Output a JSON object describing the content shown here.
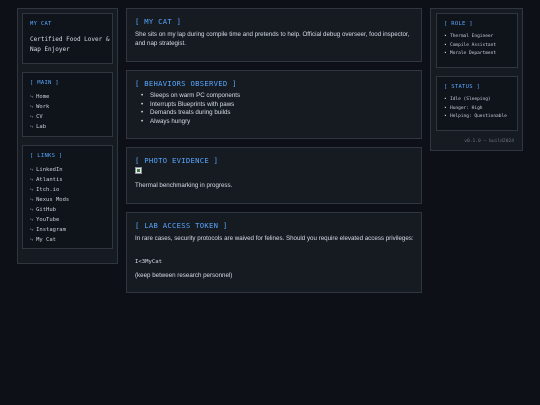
{
  "left": {
    "mycat": {
      "header": "MY CAT",
      "text": "Certified Food Lover & Nap Enjoyer"
    },
    "main": {
      "header": "[ MAIN ]",
      "items": [
        "Home",
        "Work",
        "CV",
        "Lab"
      ]
    },
    "links": {
      "header": "[ LINKS ]",
      "items": [
        "LinkedIn",
        "Atlantis",
        "Itch.io",
        "Nexus Mods",
        "GitHub",
        "YouTube",
        "Instagram",
        "My Cat"
      ]
    },
    "arrow": "⤷"
  },
  "main": {
    "about": {
      "header": "[ MY CAT ]",
      "text": "She sits on my lap during compile time and pretends to help. Official debug overseer, food inspector, and nap strategist."
    },
    "behaviors": {
      "header": "[ BEHAVIORS OBSERVED ]",
      "items": [
        "Sleeps on warm PC components",
        "Interrupts Blueprints with paws",
        "Demands treats during builds",
        "Always hungry"
      ]
    },
    "photo": {
      "header": "[ PHOTO EVIDENCE ]",
      "caption": "Thermal benchmarking in progress."
    },
    "token": {
      "header": "[ LAB ACCESS TOKEN ]",
      "text": "In rare cases, security protocols are waived for felines. Should you require elevated access privileges:",
      "code": "I<3MyCat",
      "note": "(keep between research personnel)"
    }
  },
  "right": {
    "role": {
      "header": "[ ROLE ]",
      "items": [
        "Thermal Engineer",
        "Compile Assistant",
        "Morale Department"
      ]
    },
    "status": {
      "header": "[ STATUS ]",
      "items": [
        "Idle (Sleeping)",
        "Hunger: High",
        "Helping: Questionable"
      ]
    },
    "version": "v0.1.0 — build2024"
  },
  "colors": {
    "background": "#0d1016",
    "panel": "#161b22",
    "accent": "#58a6ff",
    "border": "#30363d"
  }
}
